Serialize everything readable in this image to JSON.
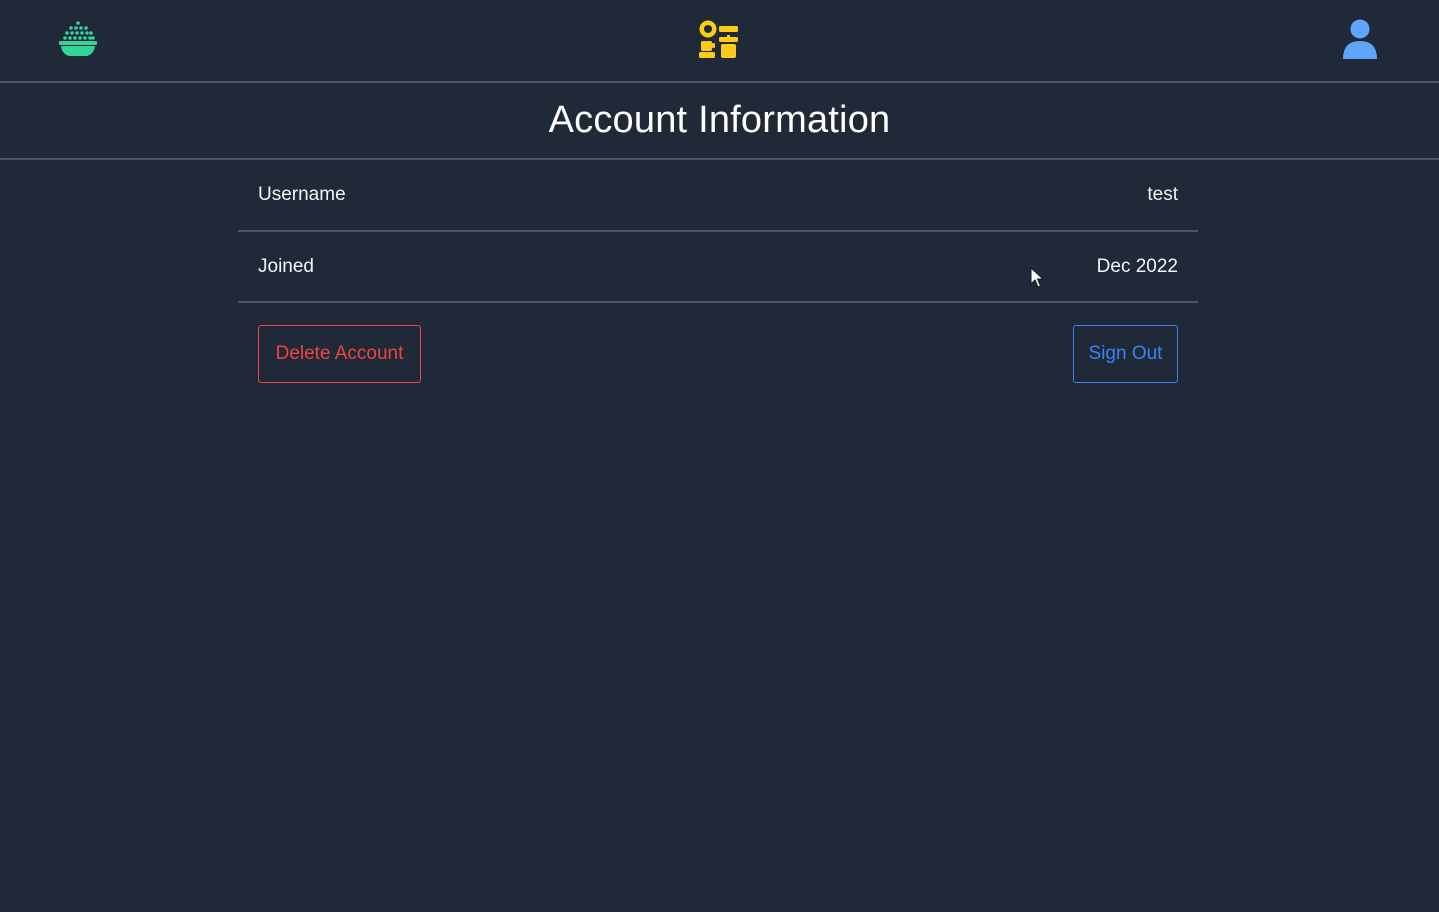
{
  "header": {
    "home_icon": "rice-bowl-icon",
    "tools_icon": "kitchen-tools-icon",
    "profile_icon": "user-icon"
  },
  "page": {
    "title": "Account Information"
  },
  "account": {
    "rows": [
      {
        "label": "Username",
        "value": "test"
      },
      {
        "label": "Joined",
        "value": "Dec 2022"
      }
    ]
  },
  "actions": {
    "delete_label": "Delete Account",
    "signout_label": "Sign Out"
  },
  "colors": {
    "background": "#1f2937",
    "divider": "#4b5563",
    "home_icon": "#34d399",
    "tools_icon": "#facc15",
    "user_icon": "#60a5fa",
    "danger": "#ef4444",
    "primary": "#3b82f6"
  }
}
